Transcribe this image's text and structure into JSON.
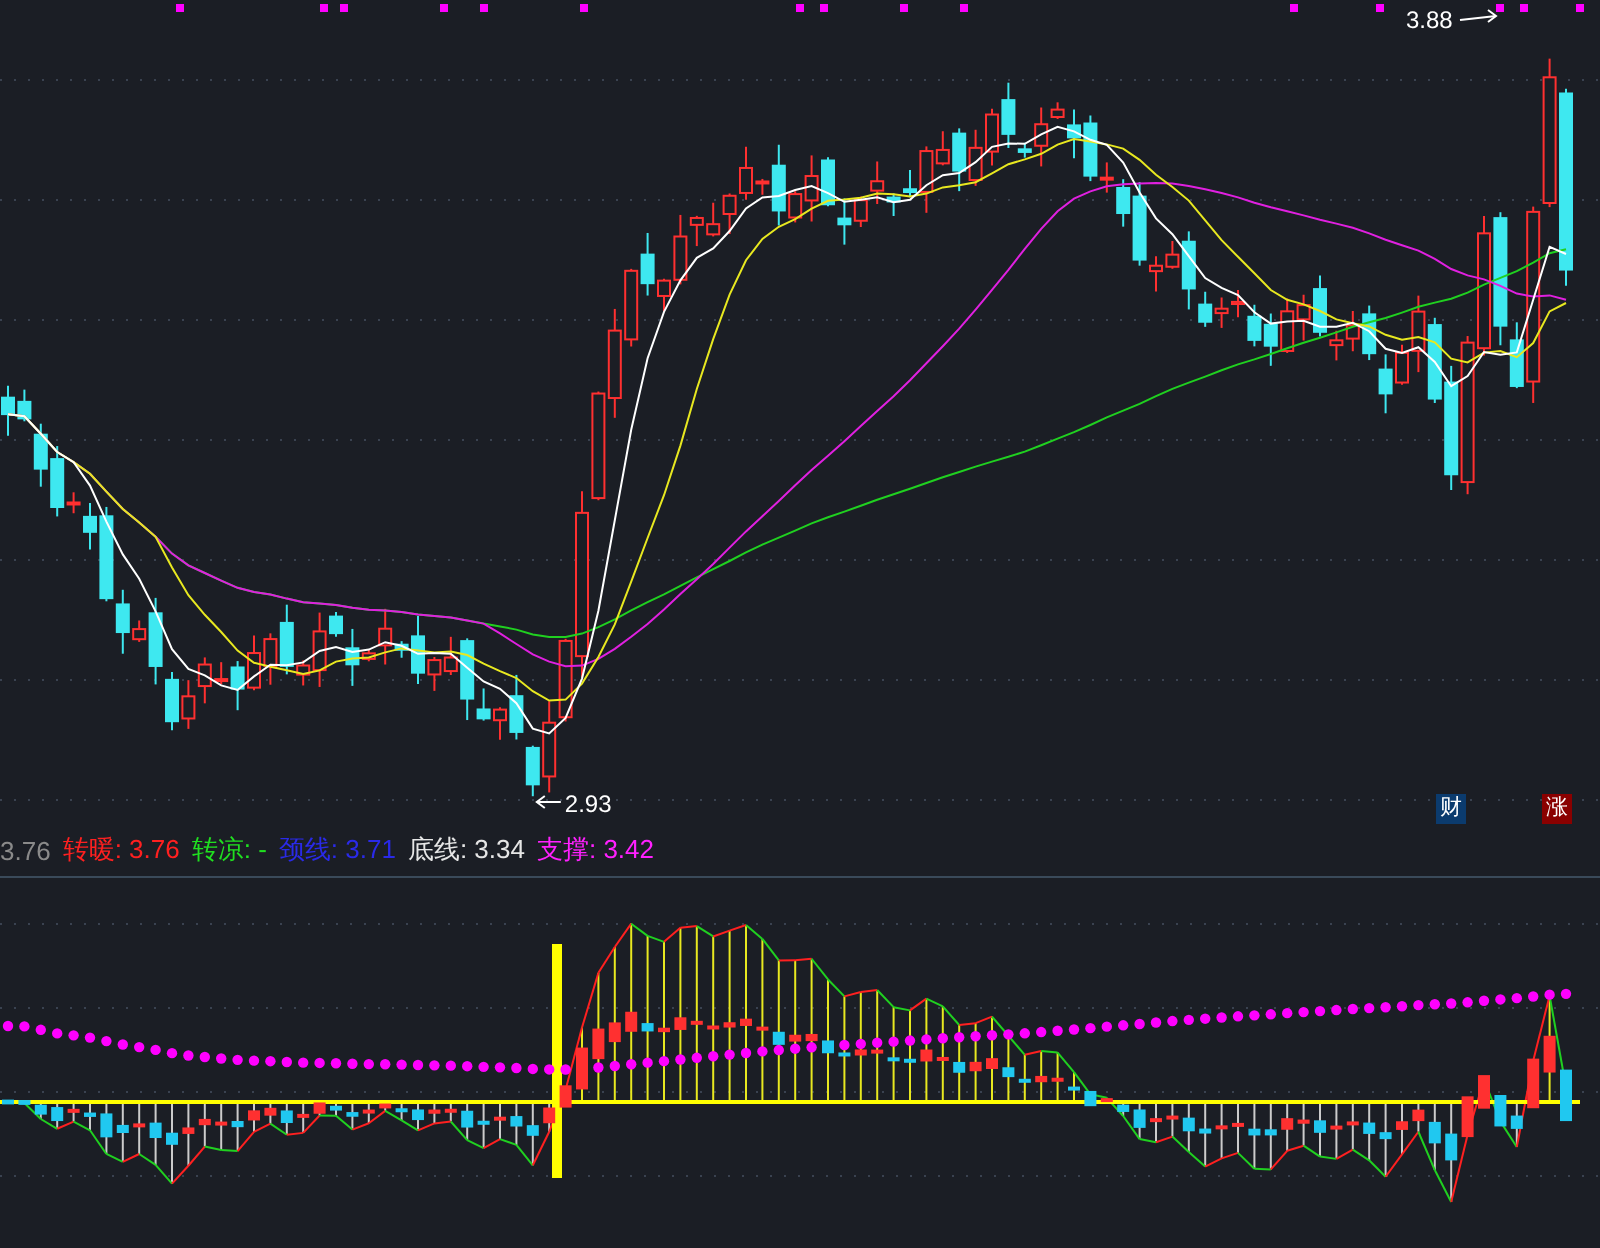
{
  "main_chart": {
    "high_label": "3.88",
    "low_label": "2.93"
  },
  "badges": [
    {
      "text": "财",
      "color": "#0b3b6e"
    },
    {
      "text": "涨",
      "color": "#8a0000"
    }
  ],
  "legend": [
    {
      "text": "3.76",
      "color": "#8a8a8a"
    },
    {
      "text": "转暖: 3.76",
      "color": "#ff2020"
    },
    {
      "text": "转凉: -",
      "color": "#20e020"
    },
    {
      "text": "颈线: 3.71",
      "color": "#2a2ae8"
    },
    {
      "text": "底线: 3.34",
      "color": "#e6e6e6"
    },
    {
      "text": "支撑: 3.42",
      "color": "#ff20ff"
    }
  ]
}
